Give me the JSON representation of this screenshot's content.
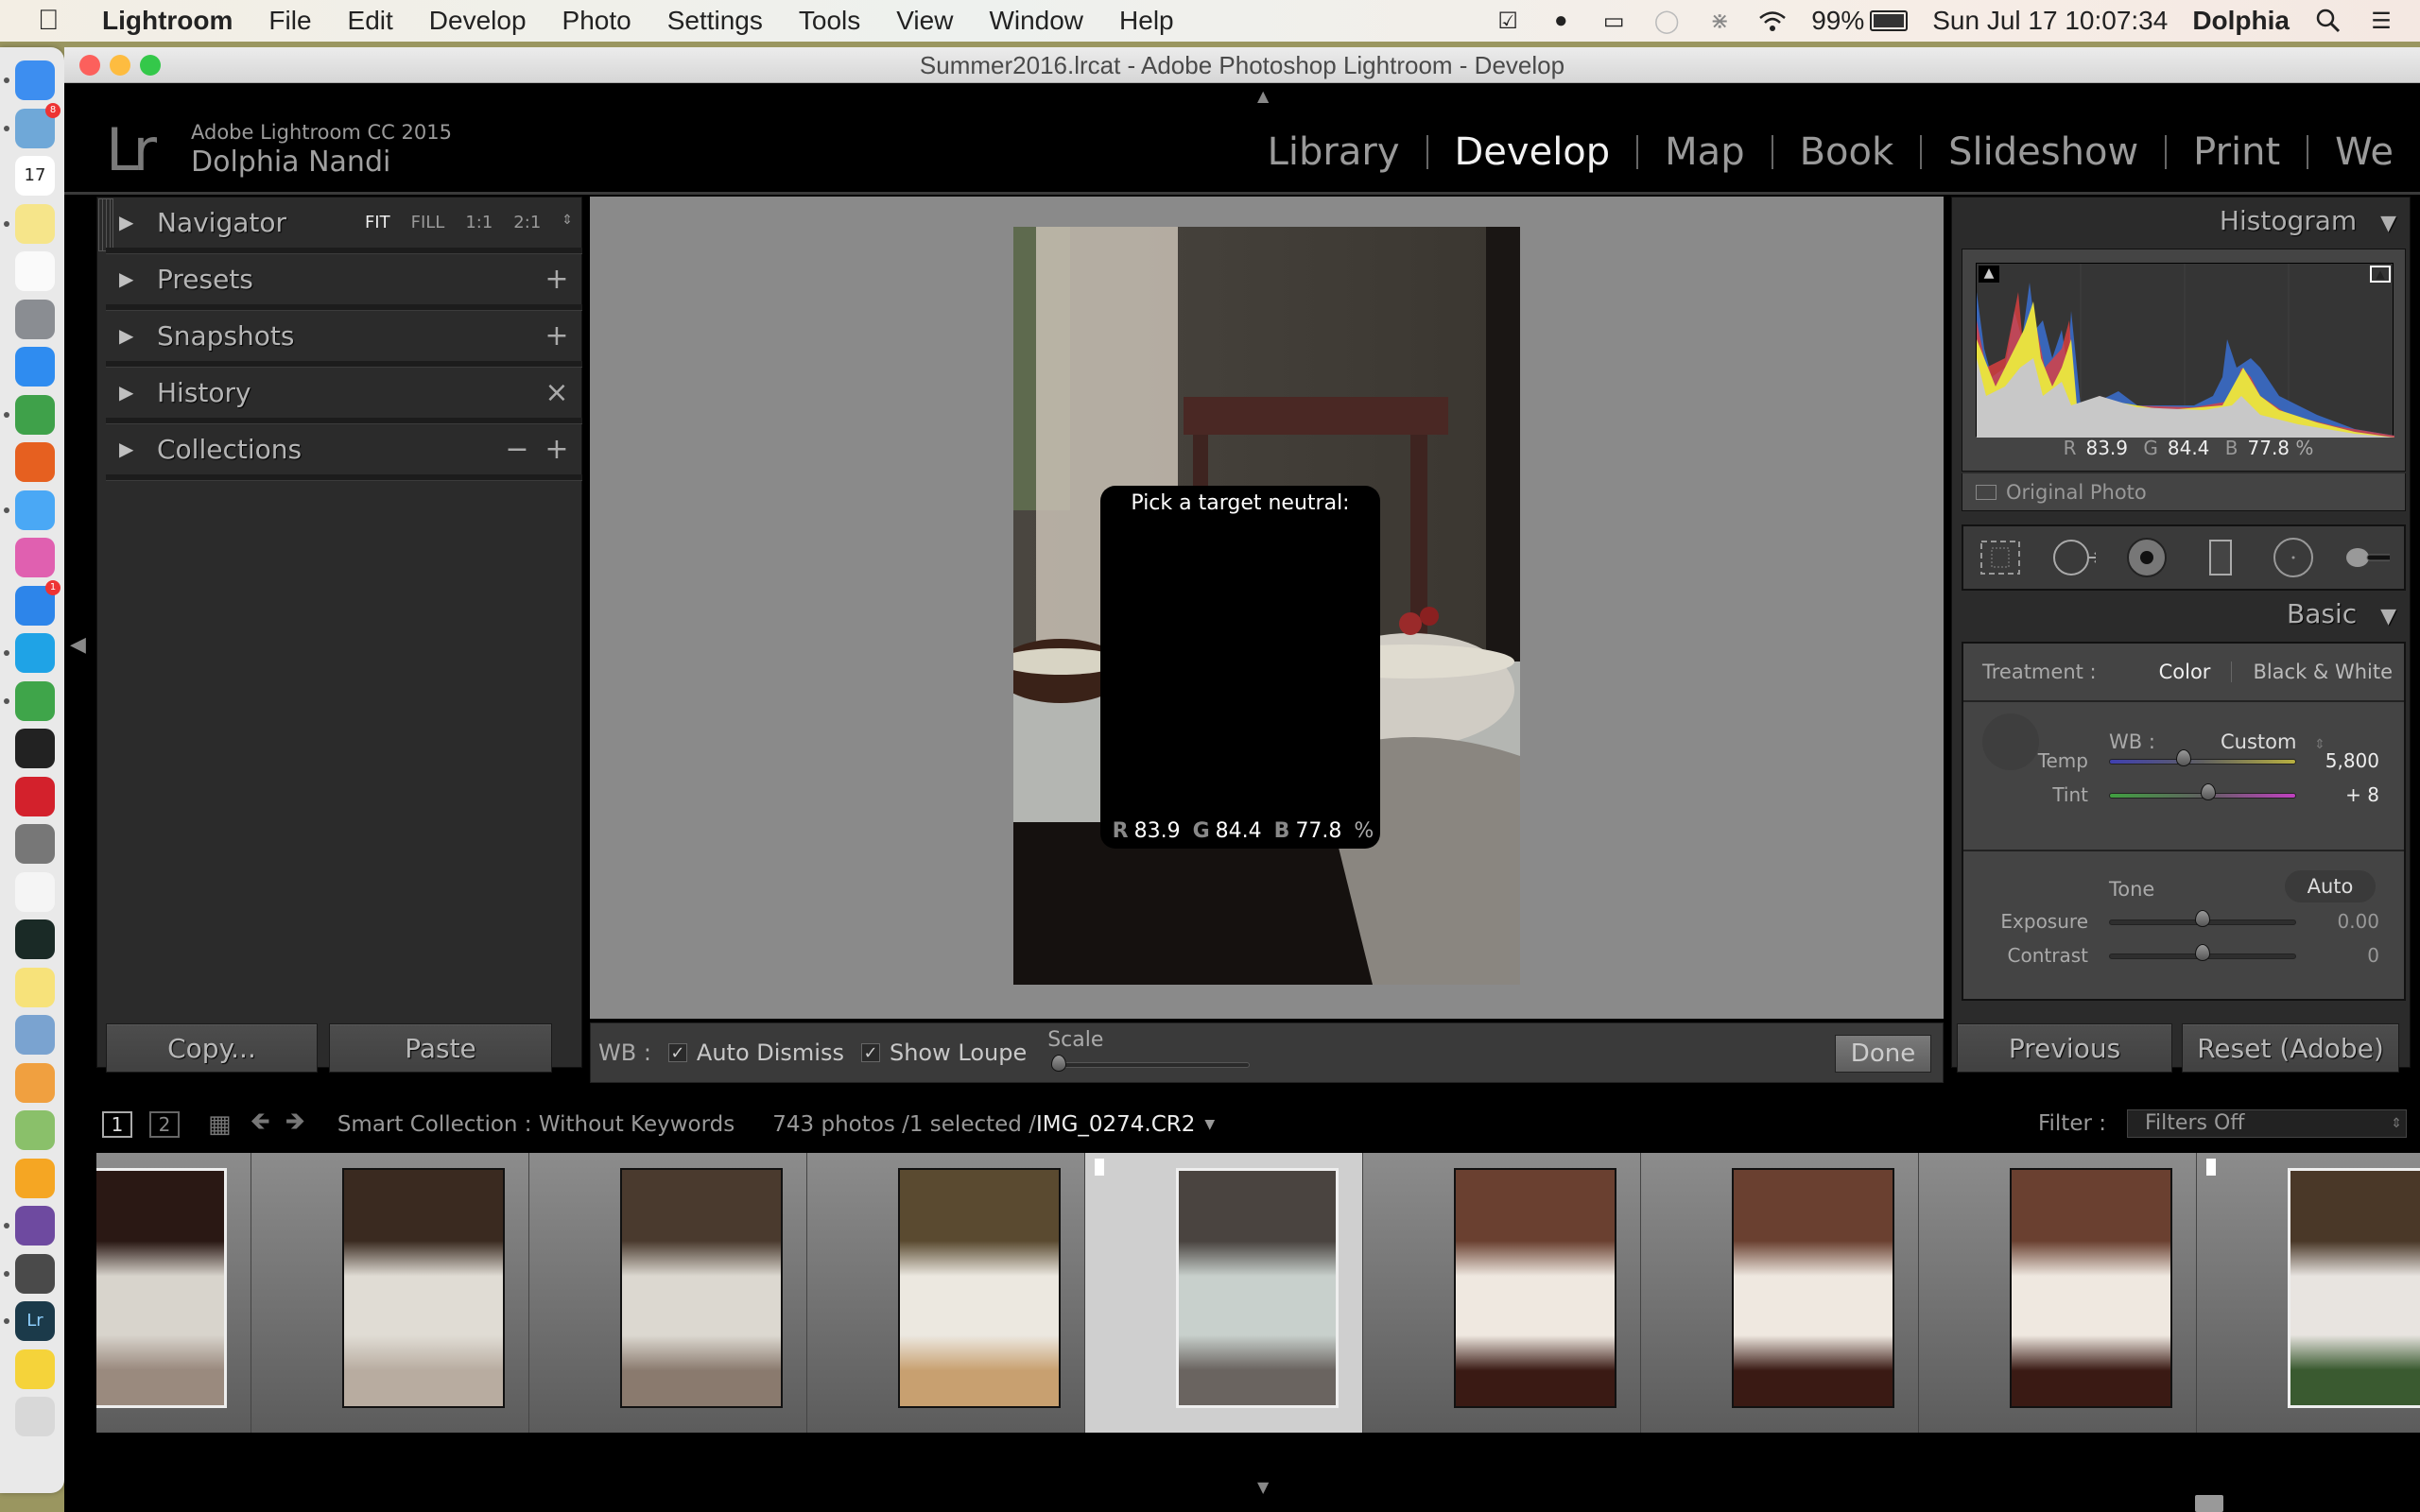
{
  "menubar": {
    "app_name": "Lightroom",
    "menus": [
      "File",
      "Edit",
      "Develop",
      "Photo",
      "Settings",
      "Tools",
      "View",
      "Window",
      "Help"
    ],
    "battery": "99%",
    "datetime": "Sun Jul 17  10:07:34",
    "user": "Dolphia",
    "status_icons": [
      "todo-check-icon",
      "evernote-icon",
      "airplay-icon",
      "messages-icon",
      "bluetooth-icon",
      "wifi-icon",
      "battery-icon"
    ]
  },
  "dock": {
    "apps": [
      {
        "name": "finder",
        "color": "#3d8ef0",
        "running": true
      },
      {
        "name": "mail",
        "color": "#6fa8d8",
        "running": true,
        "badge": "8"
      },
      {
        "name": "calendar",
        "color": "#ffffff",
        "running": false,
        "label": "17"
      },
      {
        "name": "stickies",
        "color": "#f6e58a",
        "running": true
      },
      {
        "name": "reminders",
        "color": "#fafafa",
        "running": false
      },
      {
        "name": "launchpad",
        "color": "#8a8d92",
        "running": false
      },
      {
        "name": "safari",
        "color": "#2f8cf0",
        "running": false
      },
      {
        "name": "chrome",
        "color": "#3fa14a",
        "running": true
      },
      {
        "name": "firefox",
        "color": "#e66020",
        "running": false
      },
      {
        "name": "messages",
        "color": "#4aa8f5",
        "running": true
      },
      {
        "name": "itunes",
        "color": "#e060b0",
        "running": false
      },
      {
        "name": "app-store",
        "color": "#2d85ea",
        "running": false,
        "badge": "1"
      },
      {
        "name": "skype",
        "color": "#1fa3e6",
        "running": true
      },
      {
        "name": "evernote",
        "color": "#3fa54a",
        "running": true
      },
      {
        "name": "terminal",
        "color": "#222222",
        "running": false
      },
      {
        "name": "creative-cloud",
        "color": "#d3212c",
        "running": false
      },
      {
        "name": "system-preferences",
        "color": "#777777",
        "running": false
      },
      {
        "name": "textedit",
        "color": "#f5f5f5",
        "running": false
      },
      {
        "name": "activity-monitor",
        "color": "#1a2a26",
        "running": false
      },
      {
        "name": "notes",
        "color": "#f7e27a",
        "running": false
      },
      {
        "name": "preview",
        "color": "#7aa3d0",
        "running": false
      },
      {
        "name": "photos",
        "color": "#f0a040",
        "running": false
      },
      {
        "name": "maps",
        "color": "#8ac06a",
        "running": false
      },
      {
        "name": "sketch",
        "color": "#f5a623",
        "running": false
      },
      {
        "name": "github-desktop",
        "color": "#6e4aa0",
        "running": true
      },
      {
        "name": "sublime-text",
        "color": "#4a4a4a",
        "running": true
      },
      {
        "name": "lightroom",
        "color": "#1b3a4a",
        "running": true,
        "label": "Lr"
      },
      {
        "name": "documents",
        "color": "#f5d33a",
        "running": false
      },
      {
        "name": "trash",
        "color": "#d8d8d8",
        "running": false
      }
    ]
  },
  "window": {
    "title": "Summer2016.lrcat - Adobe Photoshop Lightroom - Develop"
  },
  "identity": {
    "logo": "Lr",
    "product": "Adobe Lightroom CC 2015",
    "user": "Dolphia Nandi"
  },
  "modules": [
    {
      "label": "Library",
      "active": false
    },
    {
      "label": "Develop",
      "active": true
    },
    {
      "label": "Map",
      "active": false
    },
    {
      "label": "Book",
      "active": false
    },
    {
      "label": "Slideshow",
      "active": false
    },
    {
      "label": "Print",
      "active": false
    },
    {
      "label": "We",
      "active": false
    }
  ],
  "left_panel": {
    "navigator": {
      "title": "Navigator",
      "zoom_options": [
        "FIT",
        "FILL",
        "1:1",
        "2:1"
      ],
      "zoom_selected": "FIT"
    },
    "panels": [
      {
        "title": "Presets",
        "action": "+"
      },
      {
        "title": "Snapshots",
        "action": "+"
      },
      {
        "title": "History",
        "action": "×"
      },
      {
        "title": "Collections",
        "action": "+",
        "action2": "−"
      }
    ],
    "copy_label": "Copy...",
    "paste_label": "Paste"
  },
  "loupe": {
    "title": "Pick a target neutral:",
    "r": "83.9",
    "g": "84.4",
    "b": "77.8",
    "unit": "%",
    "swatch_color": "#ddd9c7",
    "grid_size": 5
  },
  "toolbar": {
    "wb_label": "WB :",
    "auto_dismiss_label": "Auto Dismiss",
    "auto_dismiss_checked": true,
    "show_loupe_label": "Show Loupe",
    "show_loupe_checked": true,
    "scale_label": "Scale",
    "scale_value": 0,
    "done_label": "Done"
  },
  "right_panel": {
    "histogram": {
      "title": "Histogram",
      "r": "83.9",
      "g": "84.4",
      "b": "77.8",
      "unit": "%",
      "original_photo_label": "Original Photo"
    },
    "tools": [
      "crop-overlay-icon",
      "spot-removal-icon",
      "red-eye-icon",
      "graduated-filter-icon",
      "radial-filter-icon",
      "adjustment-brush-icon"
    ],
    "basic": {
      "title": "Basic",
      "treatment_label": "Treatment :",
      "treatment_color": "Color",
      "treatment_bw": "Black & White",
      "wb_label": "WB :",
      "wb_value": "Custom",
      "sliders_wb": [
        {
          "name": "Temp",
          "value": "5,800",
          "fraction": 0.4
        },
        {
          "name": "Tint",
          "value": "+ 8",
          "fraction": 0.53
        }
      ],
      "tone_label": "Tone",
      "auto_label": "Auto",
      "sliders_tone": [
        {
          "name": "Exposure",
          "value": "0.00",
          "fraction": 0.5
        },
        {
          "name": "Contrast",
          "value": "0",
          "fraction": 0.5
        }
      ]
    },
    "previous_label": "Previous",
    "reset_label": "Reset (Adobe)"
  },
  "filmstrip": {
    "page1": "1",
    "page2": "2",
    "source": "Smart Collection : Without Keywords",
    "count": "743 photos /1 selected /",
    "filename": "IMG_0274.CR2",
    "filter_label": "Filter :",
    "filter_value": "Filters Off",
    "thumbs": [
      {
        "colors": [
          "#2a1814",
          "#d8d4cc",
          "#9a8a7e"
        ],
        "selected": false
      },
      {
        "colors": [
          "#3a2a20",
          "#e0dcd4",
          "#b8aca0"
        ],
        "selected": false
      },
      {
        "colors": [
          "#4a3a2e",
          "#dcd8d0",
          "#8a7a6e"
        ],
        "selected": false
      },
      {
        "colors": [
          "#5a4a30",
          "#ece8e0",
          "#c8a070"
        ],
        "selected": false
      },
      {
        "colors": [
          "#4a4440",
          "#c8d0cc",
          "#6a6460"
        ],
        "selected": true
      },
      {
        "colors": [
          "#6a4030",
          "#efe8e0",
          "#3a1a14"
        ],
        "selected": false
      },
      {
        "colors": [
          "#6a4030",
          "#efe8e0",
          "#3a1a14"
        ],
        "selected": false
      },
      {
        "colors": [
          "#6a4030",
          "#efe8e0",
          "#3a1a14"
        ],
        "selected": false
      },
      {
        "colors": [
          "#4a3828",
          "#e8e4e0",
          "#3a5a30"
        ],
        "selected": false
      }
    ]
  }
}
